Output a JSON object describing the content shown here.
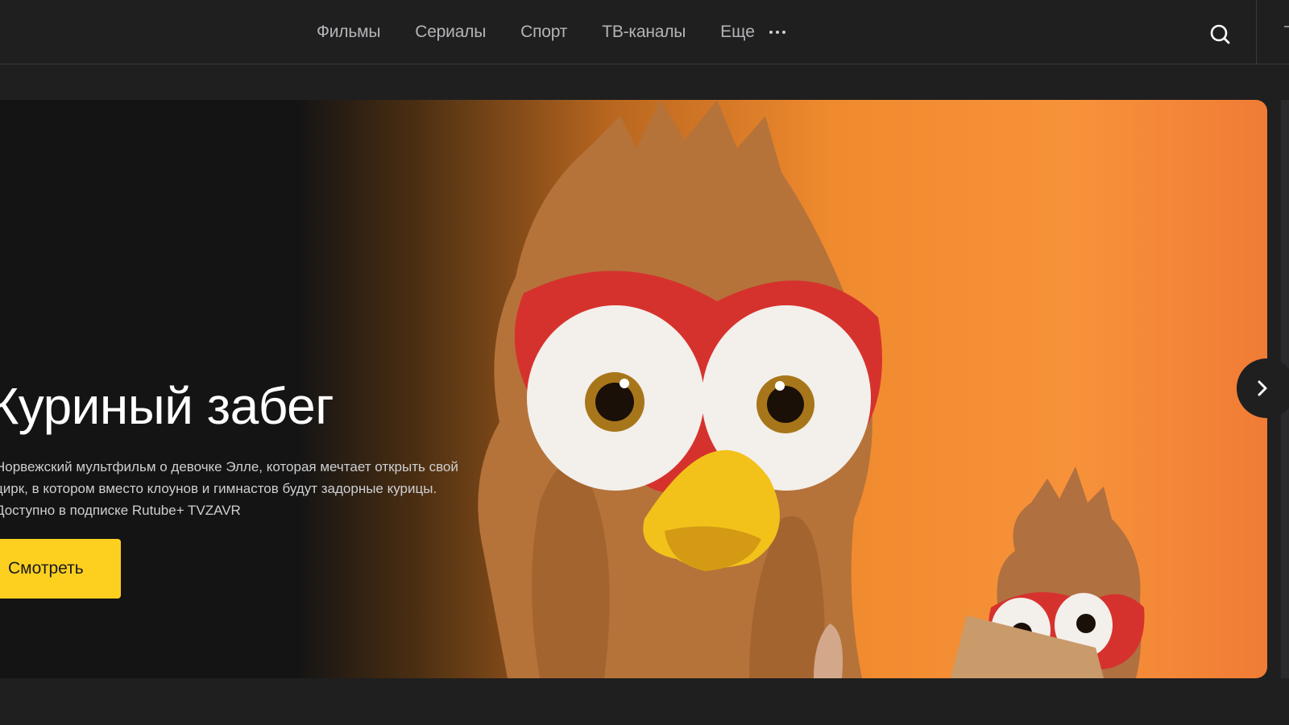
{
  "nav": {
    "items": [
      "Фильмы",
      "Сериалы",
      "Спорт",
      "ТВ-каналы"
    ],
    "more_label": "Еще"
  },
  "banner": {
    "title": "Куриный забег",
    "description_lines": [
      "Норвежский мультфильм о девочке Элле, которая мечтает открыть свой",
      "цирк, в котором вместо клоунов и гимнастов будут задорные курицы.",
      "Доступно в подписке Rutube+ TVZAVR"
    ],
    "watch_label": "Смотреть"
  },
  "icons": {
    "search": "search-icon",
    "more": "ellipsis-icon",
    "next": "chevron-right-icon"
  },
  "colors": {
    "background": "#1f1f20",
    "accent_button": "#fdd020",
    "nav_text": "#b4b4b8"
  }
}
